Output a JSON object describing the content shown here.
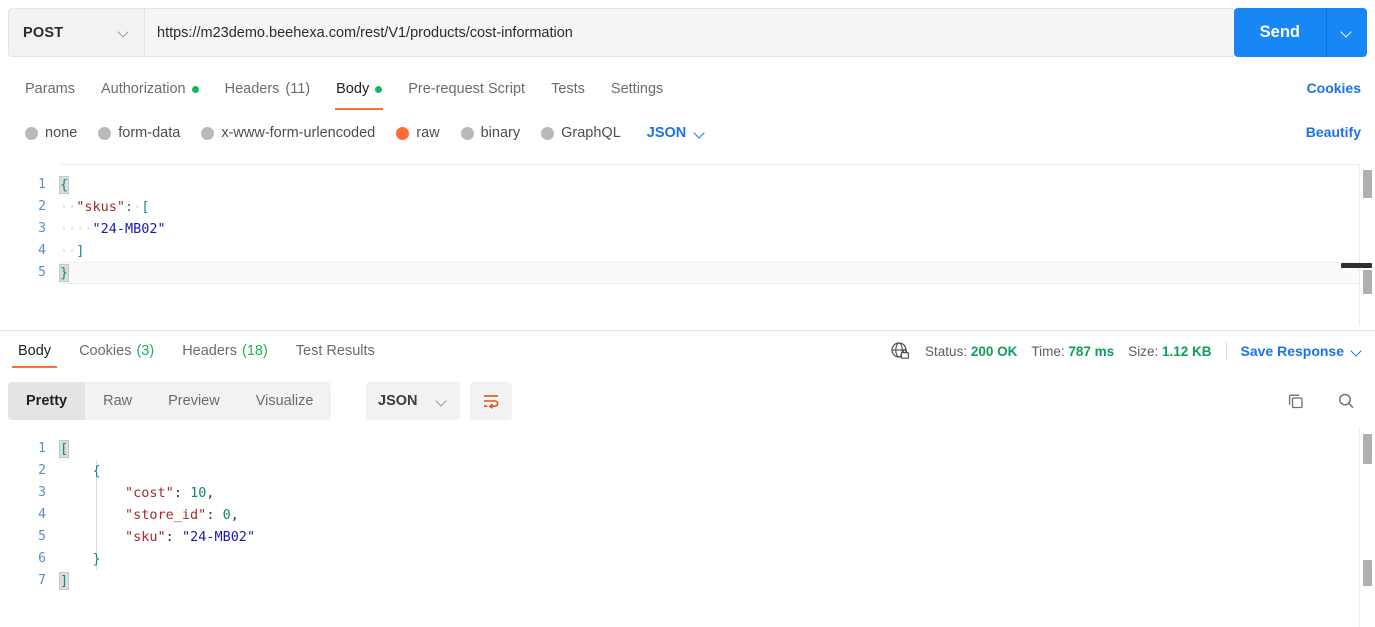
{
  "request": {
    "method": "POST",
    "url": "https://m23demo.beehexa.com/rest/V1/products/cost-information",
    "send_label": "Send",
    "tabs": [
      {
        "label": "Params",
        "badge": "",
        "dot": false,
        "active": false
      },
      {
        "label": "Authorization",
        "badge": "",
        "dot": true,
        "active": false
      },
      {
        "label": "Headers",
        "badge": "(11)",
        "dot": false,
        "active": false
      },
      {
        "label": "Body",
        "badge": "",
        "dot": true,
        "active": true
      },
      {
        "label": "Pre-request Script",
        "badge": "",
        "dot": false,
        "active": false
      },
      {
        "label": "Tests",
        "badge": "",
        "dot": false,
        "active": false
      },
      {
        "label": "Settings",
        "badge": "",
        "dot": false,
        "active": false
      }
    ],
    "cookies_link": "Cookies",
    "beautify_link": "Beautify",
    "body_types": [
      {
        "label": "none",
        "selected": false
      },
      {
        "label": "form-data",
        "selected": false
      },
      {
        "label": "x-www-form-urlencoded",
        "selected": false
      },
      {
        "label": "raw",
        "selected": true
      },
      {
        "label": "binary",
        "selected": false
      },
      {
        "label": "GraphQL",
        "selected": false
      }
    ],
    "raw_format": "JSON",
    "body_lines": [
      {
        "n": "1",
        "tokens": [
          {
            "t": "{",
            "c": "tok-punc brk-hl"
          }
        ],
        "active": false
      },
      {
        "n": "2",
        "tokens": [
          {
            "t": "··",
            "c": "tok-ws"
          },
          {
            "t": "\"skus\"",
            "c": "tok-key"
          },
          {
            "t": ":",
            "c": "tok-punc"
          },
          {
            "t": "·",
            "c": "tok-ws"
          },
          {
            "t": "[",
            "c": "tok-punc"
          }
        ],
        "active": false
      },
      {
        "n": "3",
        "tokens": [
          {
            "t": "····",
            "c": "tok-ws"
          },
          {
            "t": "\"24-MB02\"",
            "c": "tok-str"
          }
        ],
        "active": false
      },
      {
        "n": "4",
        "tokens": [
          {
            "t": "··",
            "c": "tok-ws"
          },
          {
            "t": "]",
            "c": "tok-punc"
          }
        ],
        "active": false
      },
      {
        "n": "5",
        "tokens": [
          {
            "t": "}",
            "c": "tok-punc brk-hl"
          }
        ],
        "active": true
      }
    ]
  },
  "response": {
    "tabs": [
      {
        "label": "Body",
        "badge": "",
        "active": true
      },
      {
        "label": "Cookies",
        "badge": "(3)",
        "active": false
      },
      {
        "label": "Headers",
        "badge": "(18)",
        "active": false
      },
      {
        "label": "Test Results",
        "badge": "",
        "active": false
      }
    ],
    "status_label": "Status:",
    "status_value": "200 OK",
    "time_label": "Time:",
    "time_value": "787 ms",
    "size_label": "Size:",
    "size_value": "1.12 KB",
    "save_response": "Save Response",
    "view_modes": [
      {
        "label": "Pretty",
        "active": true
      },
      {
        "label": "Raw",
        "active": false
      },
      {
        "label": "Preview",
        "active": false
      },
      {
        "label": "Visualize",
        "active": false
      }
    ],
    "format": "JSON",
    "body_lines": [
      {
        "n": "1",
        "tokens": [
          {
            "t": "[",
            "c": "tok-punc brk-hl"
          }
        ]
      },
      {
        "n": "2",
        "tokens": [
          {
            "t": "    ",
            "c": "tok-ws"
          },
          {
            "t": "{",
            "c": "tok-punc"
          }
        ]
      },
      {
        "n": "3",
        "tokens": [
          {
            "t": "        ",
            "c": "tok-ws"
          },
          {
            "t": "\"cost\"",
            "c": "tok-key"
          },
          {
            "t": ": ",
            "c": "tok-plain"
          },
          {
            "t": "10",
            "c": "tok-num"
          },
          {
            "t": ",",
            "c": "tok-plain"
          }
        ]
      },
      {
        "n": "4",
        "tokens": [
          {
            "t": "        ",
            "c": "tok-ws"
          },
          {
            "t": "\"store_id\"",
            "c": "tok-key"
          },
          {
            "t": ": ",
            "c": "tok-plain"
          },
          {
            "t": "0",
            "c": "tok-num"
          },
          {
            "t": ",",
            "c": "tok-plain"
          }
        ]
      },
      {
        "n": "5",
        "tokens": [
          {
            "t": "        ",
            "c": "tok-ws"
          },
          {
            "t": "\"sku\"",
            "c": "tok-key"
          },
          {
            "t": ": ",
            "c": "tok-plain"
          },
          {
            "t": "\"24-MB02\"",
            "c": "tok-str"
          }
        ]
      },
      {
        "n": "6",
        "tokens": [
          {
            "t": "    ",
            "c": "tok-ws"
          },
          {
            "t": "}",
            "c": "tok-punc"
          }
        ]
      },
      {
        "n": "7",
        "tokens": [
          {
            "t": "]",
            "c": "tok-punc brk-hl"
          }
        ]
      }
    ]
  },
  "icons": {
    "method_chevron": "chevron-down-icon",
    "send_chevron": "chevron-down-icon",
    "globe_lock": "globe-lock-icon",
    "copy": "copy-icon",
    "search": "search-icon",
    "word_wrap": "word-wrap-icon"
  },
  "colors": {
    "accent_orange": "#ff6c37",
    "link_blue": "#1a73e8",
    "send_blue": "#1787f5",
    "success_green": "#0f9d58",
    "dot_green": "#1bb35d"
  }
}
